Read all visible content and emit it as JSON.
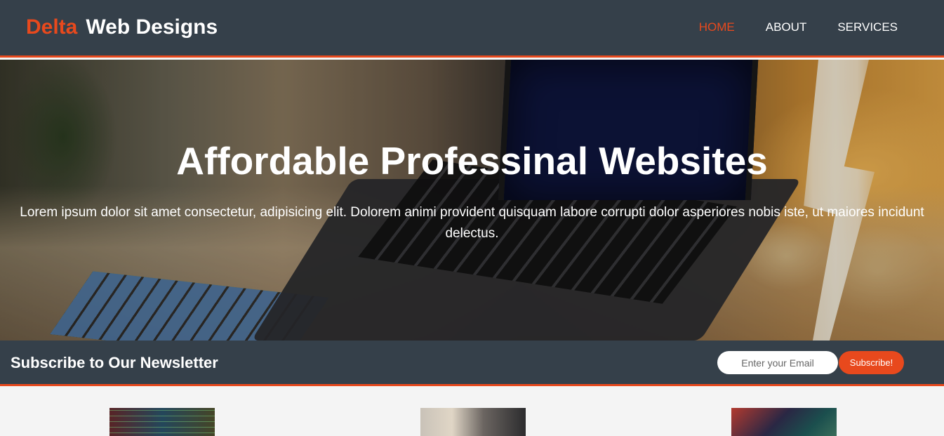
{
  "header": {
    "brand_highlight": "Delta",
    "brand_rest": "Web Designs",
    "nav": [
      {
        "label": "HOME",
        "active": true
      },
      {
        "label": "ABOUT",
        "active": false
      },
      {
        "label": "SERVICES",
        "active": false
      }
    ]
  },
  "hero": {
    "title": "Affordable Professinal Websites",
    "text": "Lorem ipsum dolor sit amet consectetur, adipisicing elit. Dolorem animi provident quisquam labore corrupti dolor asperiores nobis iste, ut maiores incidunt delectus."
  },
  "newsletter": {
    "heading": "Subscribe to Our Newsletter",
    "email_placeholder": "Enter your Email",
    "email_value": "",
    "button_label": "Subscribe!"
  },
  "colors": {
    "accent": "#e8491d",
    "dark": "#35404a",
    "background": "#f4f4f4"
  }
}
